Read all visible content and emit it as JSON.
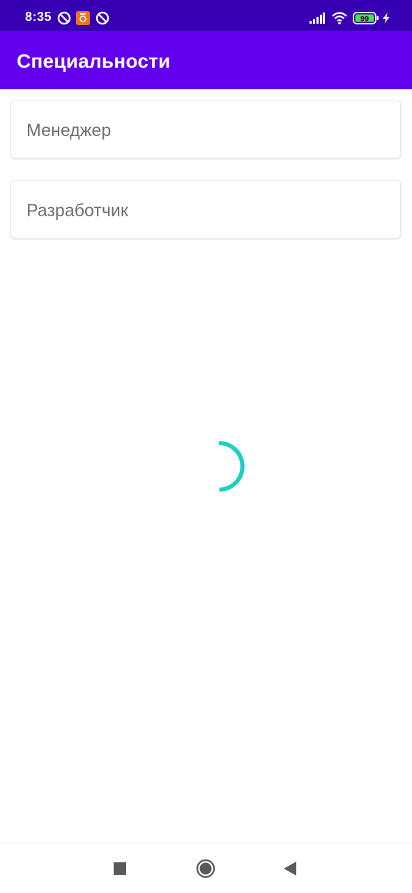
{
  "status_bar": {
    "time": "8:35",
    "battery_level": "99",
    "background_color": "#3700b3"
  },
  "app_bar": {
    "title": "Специальности",
    "background_color": "#6200ee"
  },
  "specialties": [
    {
      "label": "Менеджер"
    },
    {
      "label": "Разработчик"
    }
  ],
  "loading": {
    "spinner_color": "#1ad1c3"
  },
  "nav_bar": {
    "buttons": [
      "recents-icon",
      "home-icon",
      "back-icon"
    ]
  }
}
